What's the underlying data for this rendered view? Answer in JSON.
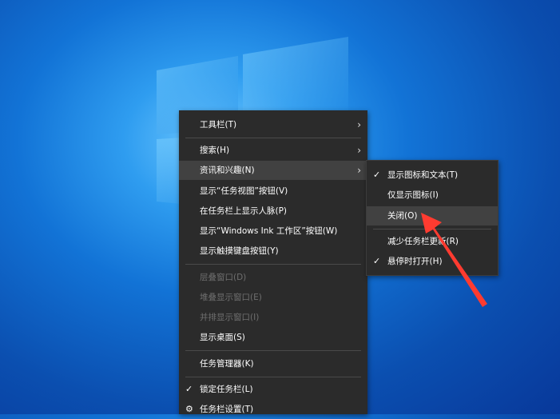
{
  "main_menu": {
    "items": [
      {
        "label": "工具栏(T)"
      },
      {
        "label": "搜索(H)"
      },
      {
        "label": "资讯和兴趣(N)"
      },
      {
        "label": "显示“任务视图”按钮(V)"
      },
      {
        "label": "在任务栏上显示人脉(P)"
      },
      {
        "label": "显示“Windows Ink 工作区”按钮(W)"
      },
      {
        "label": "显示触摸键盘按钮(Y)"
      },
      {
        "label": "层叠窗口(D)"
      },
      {
        "label": "堆叠显示窗口(E)"
      },
      {
        "label": "并排显示窗口(I)"
      },
      {
        "label": "显示桌面(S)"
      },
      {
        "label": "任务管理器(K)"
      },
      {
        "label": "锁定任务栏(L)"
      },
      {
        "label": "任务栏设置(T)"
      }
    ]
  },
  "sub_menu": {
    "items": [
      {
        "label": "显示图标和文本(T)"
      },
      {
        "label": "仅显示图标(I)"
      },
      {
        "label": "关闭(O)"
      },
      {
        "label": "减少任务栏更新(R)"
      },
      {
        "label": "悬停时打开(H)"
      }
    ]
  },
  "icons": {
    "chevron": "›",
    "check": "✓",
    "gear": "⚙"
  },
  "colors": {
    "menu_bg": "#2b2b2b",
    "highlight": "#414141",
    "arrow": "#ff3b30"
  }
}
